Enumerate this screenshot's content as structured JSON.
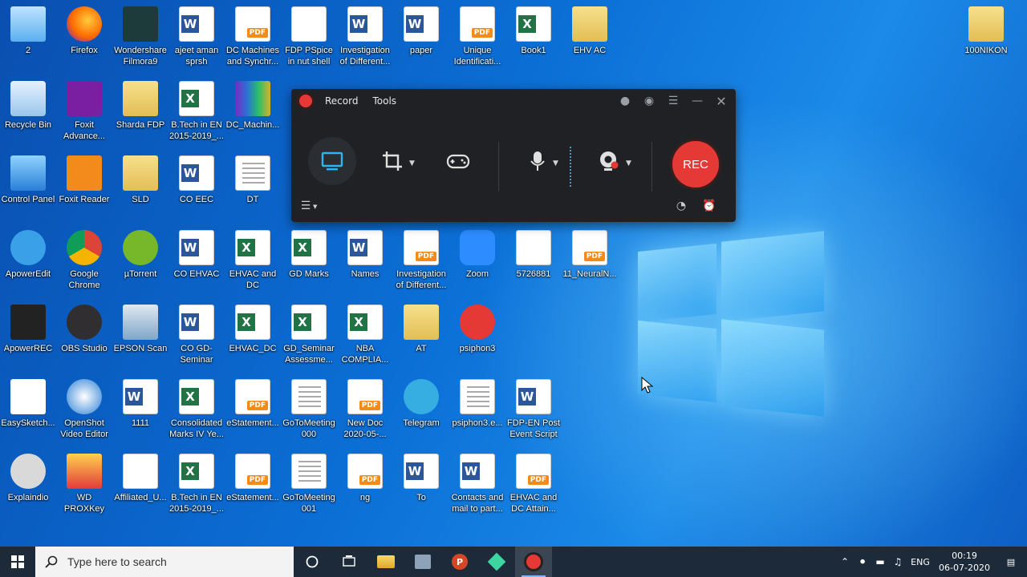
{
  "desktop": {
    "icons": [
      {
        "label": "2",
        "type": "this-pc"
      },
      {
        "label": "Firefox",
        "type": "firefox"
      },
      {
        "label": "Wondershare Filmora9",
        "type": "filmora"
      },
      {
        "label": "ajeet aman sprsh",
        "type": "word"
      },
      {
        "label": "DC Machines and Synchr...",
        "type": "pdf"
      },
      {
        "label": "FDP PSpice in nut shell",
        "type": "ppt"
      },
      {
        "label": "Investigation of Different...",
        "type": "word"
      },
      {
        "label": "paper",
        "type": "word"
      },
      {
        "label": "Unique Identificati...",
        "type": "pdf"
      },
      {
        "label": "Book1",
        "type": "excel"
      },
      {
        "label": "EHV AC",
        "type": "folder"
      },
      {
        "label": "100NIKON",
        "type": "folder"
      },
      {
        "label": "Recycle Bin",
        "type": "recycle"
      },
      {
        "label": "Foxit Advance...",
        "type": "foxit"
      },
      {
        "label": "Sharda FDP",
        "type": "folder"
      },
      {
        "label": "B.Tech in EN 2015-2019_...",
        "type": "excel"
      },
      {
        "label": "DC_Machin...",
        "type": "winrar"
      },
      {
        "label": "Control Panel",
        "type": "control-panel"
      },
      {
        "label": "Foxit Reader",
        "type": "foxit-reader"
      },
      {
        "label": "SLD",
        "type": "folder"
      },
      {
        "label": "CO EEC",
        "type": "word"
      },
      {
        "label": "DT",
        "type": "doc"
      },
      {
        "label": "ApowerEdit",
        "type": "apoweredit"
      },
      {
        "label": "Google Chrome",
        "type": "chrome"
      },
      {
        "label": "µTorrent",
        "type": "utorrent"
      },
      {
        "label": "CO EHVAC",
        "type": "word"
      },
      {
        "label": "EHVAC and DC",
        "type": "excel"
      },
      {
        "label": "GD Marks",
        "type": "excel"
      },
      {
        "label": "Names",
        "type": "word"
      },
      {
        "label": "Investigation of Different...",
        "type": "pdf"
      },
      {
        "label": "Zoom",
        "type": "zoom"
      },
      {
        "label": "5726881",
        "type": "ppt"
      },
      {
        "label": "11_NeuralN...",
        "type": "pdf"
      },
      {
        "label": "ApowerREC",
        "type": "apowerrec"
      },
      {
        "label": "OBS Studio",
        "type": "obs"
      },
      {
        "label": "EPSON Scan",
        "type": "epson"
      },
      {
        "label": "CO GD-Seminar",
        "type": "word"
      },
      {
        "label": "EHVAC_DC",
        "type": "excel"
      },
      {
        "label": "GD_Seminar Assessme...",
        "type": "excel"
      },
      {
        "label": "NBA COMPLIA...",
        "type": "excel"
      },
      {
        "label": "AT",
        "type": "folder"
      },
      {
        "label": "psiphon3",
        "type": "psiphon"
      },
      {
        "label": "EasySketch...",
        "type": "easysketch"
      },
      {
        "label": "OpenShot Video Editor",
        "type": "openshot"
      },
      {
        "label": "1111",
        "type": "word"
      },
      {
        "label": "Consolidated Marks IV Ye...",
        "type": "excel"
      },
      {
        "label": "eStatement...",
        "type": "pdf"
      },
      {
        "label": "GoToMeeting 000",
        "type": "doc"
      },
      {
        "label": "New Doc 2020-05-...",
        "type": "pdf"
      },
      {
        "label": "Telegram",
        "type": "telegram"
      },
      {
        "label": "psiphon3.e...",
        "type": "doc"
      },
      {
        "label": "FDP-EN Post Event Script",
        "type": "word"
      },
      {
        "label": "Explaindio",
        "type": "explaindio"
      },
      {
        "label": "WD PROXKey",
        "type": "proxkey"
      },
      {
        "label": "Affiliated_U...",
        "type": "affiliated"
      },
      {
        "label": "B.Tech in EN 2015-2019_...",
        "type": "excel"
      },
      {
        "label": "eStatement...",
        "type": "pdf"
      },
      {
        "label": "GoToMeeting 001",
        "type": "doc"
      },
      {
        "label": "ng",
        "type": "pdf"
      },
      {
        "label": "To",
        "type": "word"
      },
      {
        "label": "Contacts and mail to part...",
        "type": "word"
      },
      {
        "label": "EHVAC and DC Attain...",
        "type": "pdf"
      }
    ]
  },
  "recorder": {
    "menu": {
      "record": "Record",
      "tools": "Tools"
    },
    "rec_label": "REC",
    "colors": {
      "accent": "#e53935",
      "monitor": "#29b6f6",
      "bg": "#1f2124"
    }
  },
  "taskbar": {
    "search_placeholder": "Type here to search",
    "language": "ENG",
    "time": "00:19",
    "date": "06-07-2020"
  }
}
